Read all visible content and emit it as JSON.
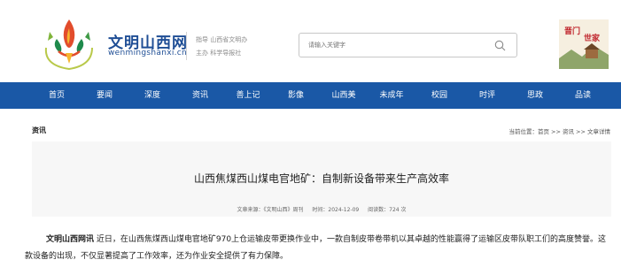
{
  "header": {
    "site_name": "文明山西网",
    "site_domain": "wenmingshanxi.cn",
    "guide_line1": "指导 山西省文明办",
    "guide_line2": "主办 科学导报社"
  },
  "search": {
    "placeholder": "请输入关键字"
  },
  "promo": {
    "label": "晋门世家 太行山礼"
  },
  "nav": {
    "items": [
      "首页",
      "要闻",
      "深度",
      "资讯",
      "善上记",
      "影像",
      "山西美",
      "未成年",
      "校园",
      "时评",
      "思政",
      "品读"
    ]
  },
  "breadcrumb": {
    "section_title": "资讯",
    "path": "当前位置：首页 >> 资讯 >> 文章详情"
  },
  "article": {
    "title": "山西焦煤西山煤电官地矿：自制新设备带来生产高效率",
    "source": "文章来源：《文明山西》周刊",
    "time": "时间：2024-12-09",
    "views": "阅读数：724 次",
    "lead": "文明山西网讯",
    "body": " 近日，在山西焦煤西山煤电官地矿970上仓运输皮带更换作业中，一款自制皮带卷带机以其卓越的性能赢得了运输区皮带队职工们的高度赞誉。这款设备的出现，不仅显著提高了工作效率，还为作业安全提供了有力保障。"
  },
  "colors": {
    "nav_bg": "#1a58a6",
    "brand_text": "#1f4e95"
  }
}
